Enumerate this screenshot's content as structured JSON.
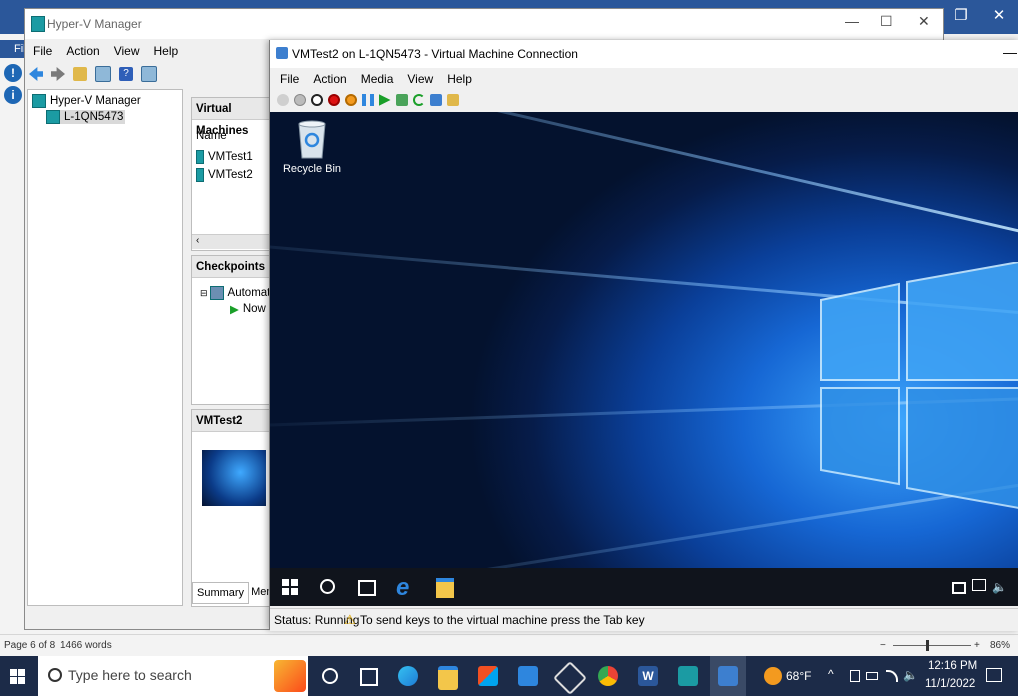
{
  "word": {
    "file_label": "Fil",
    "status_page": "Page 6 of 8",
    "status_words": "1466 words",
    "zoom": "86%",
    "zoom_minus": "−",
    "zoom_plus": "+"
  },
  "hyperv_manager": {
    "title": "Hyper-V Manager",
    "menu": [
      "File",
      "Action",
      "View",
      "Help"
    ],
    "tree": {
      "root": "Hyper-V Manager",
      "server": "L-1QN5473"
    },
    "vm_panel": {
      "header": "Virtual Machines",
      "column_name": "Name",
      "rows": [
        "VMTest1",
        "VMTest2"
      ]
    },
    "checkpoints_panel": {
      "header": "Checkpoints",
      "items": [
        "Automatic",
        "Now"
      ]
    },
    "details_panel": {
      "header": "VMTest2",
      "tabs": [
        "Summary",
        "Memor"
      ]
    }
  },
  "vm_connection": {
    "title": "VMTest2 on L-1QN5473 - Virtual Machine Connection",
    "menu": [
      "File",
      "Action",
      "Media",
      "View",
      "Help"
    ],
    "desktop_icon_label": "Recycle Bin",
    "status_text": "Status: Running",
    "status_hint": "To send keys to the virtual machine press the Tab key"
  },
  "taskbar": {
    "search_placeholder": "Type here to search",
    "weather": "68°F",
    "time": "12:16 PM",
    "date": "11/1/2022"
  }
}
